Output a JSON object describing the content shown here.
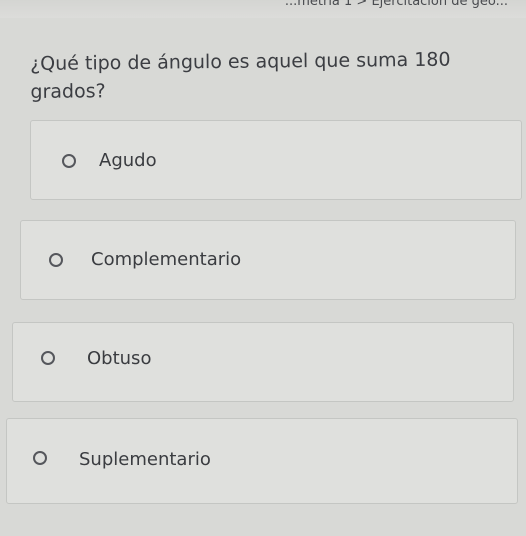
{
  "header": {
    "breadcrumb": "...metría 1 > Ejercitación de geo..."
  },
  "quiz": {
    "question": "¿Qué tipo de ángulo es aquel que suma 180 grados?",
    "options": [
      {
        "label": "Agudo",
        "selected": false
      },
      {
        "label": "Complementario",
        "selected": false
      },
      {
        "label": "Obtuso",
        "selected": false
      },
      {
        "label": "Suplementario",
        "selected": false
      }
    ]
  }
}
